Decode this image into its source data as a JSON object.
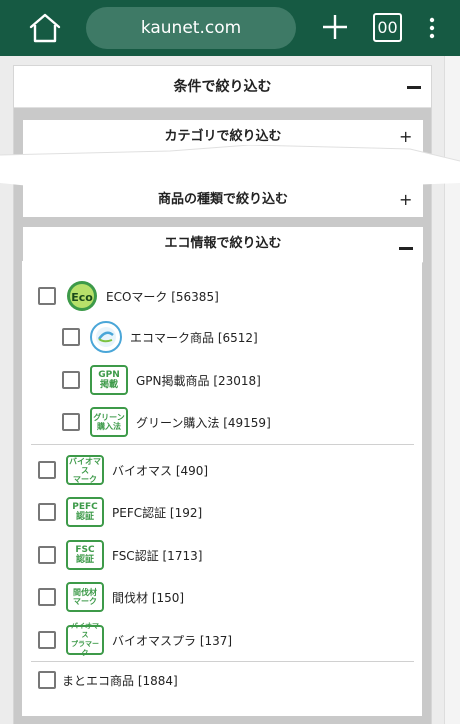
{
  "browser": {
    "url": "kaunet.com",
    "tab_count": "00"
  },
  "filter": {
    "title": "条件で絞り込む",
    "sections": [
      {
        "label": "カテゴリで絞り込む",
        "state": "collapsed"
      },
      {
        "label": "商品の種類で絞り込む",
        "state": "collapsed"
      },
      {
        "label": "エコ情報で絞り込む",
        "state": "expanded"
      }
    ],
    "eco_items": [
      {
        "label": "ECOマーク [56385]",
        "badge": "Eco",
        "icon": "eco-mark-icon"
      },
      {
        "label": "エコマーク商品 [6512]",
        "badge": "",
        "icon": "eco-mark-product-icon"
      },
      {
        "label": "GPN掲載商品 [23018]",
        "badge": "GPN\n掲載",
        "icon": "gpn-icon"
      },
      {
        "label": "グリーン購入法 [49159]",
        "badge": "グリーン\n購入法",
        "icon": "green-purchase-icon"
      },
      {
        "label": "バイオマス [490]",
        "badge": "バイオマス\nマーク",
        "icon": "biomass-icon"
      },
      {
        "label": "PEFC認証 [192]",
        "badge": "PEFC\n認証",
        "icon": "pefc-icon"
      },
      {
        "label": "FSC認証 [1713]",
        "badge": "FSC\n認証",
        "icon": "fsc-icon"
      },
      {
        "label": "間伐材 [150]",
        "badge": "間伐材\nマーク",
        "icon": "thinned-wood-icon"
      },
      {
        "label": "バイオマスプラ [137]",
        "badge": "バイオマス\nプラマーク",
        "icon": "biomass-plastic-icon"
      },
      {
        "label": "まとエコ商品 [1884]",
        "badge": "",
        "icon": ""
      }
    ]
  },
  "colors": {
    "browser_bar": "#165a43",
    "url_pill": "#3e7a66",
    "eco_green": "#3d9a49"
  }
}
